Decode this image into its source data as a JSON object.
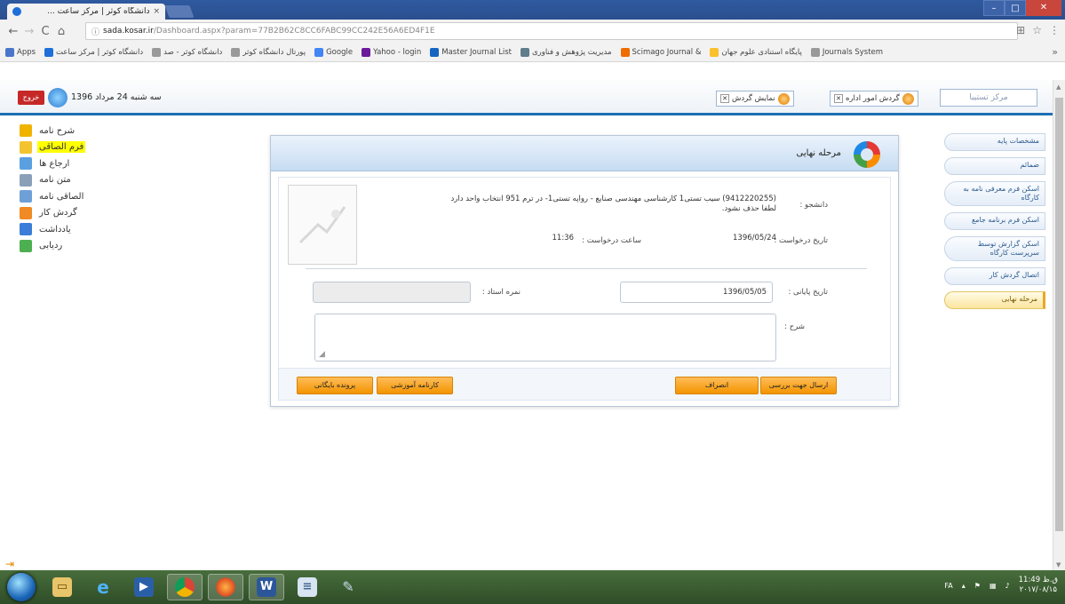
{
  "browser": {
    "tab_title": "دانشگاه کوثر | مرکز ساعت ...",
    "tab_close": "×",
    "address_domain": "sada.kosar.ir",
    "address_path": "/Dashboard.aspx?param=77B2B62C8CC6FABC99CC242E56A6ED4F1E",
    "bookmarks": [
      {
        "label": "Apps",
        "icon": "apps-icon",
        "color": "#4a76c9"
      },
      {
        "label": "دانشگاه کوثر | مرکز ساعت",
        "icon": "site-icon",
        "color": "#1e6fd9"
      },
      {
        "label": "دانشگاه کوثر - صد",
        "icon": "page-icon",
        "color": "#999999"
      },
      {
        "label": "پورتال دانشگاه کوثر",
        "icon": "page-icon",
        "color": "#999999"
      },
      {
        "label": "Google",
        "icon": "google-icon",
        "color": "#4285f4"
      },
      {
        "label": "Yahoo - login",
        "icon": "yahoo-icon",
        "color": "#6a1b9a"
      },
      {
        "label": "Master Journal List",
        "icon": "journal-icon",
        "color": "#1565c0"
      },
      {
        "label": "مدیریت پژوهش و فناوری",
        "icon": "grid-icon",
        "color": "#607d8b"
      },
      {
        "label": "Scimago Journal &",
        "icon": "scimago-icon",
        "color": "#ef6c00"
      },
      {
        "label": "پایگاه استنادی علوم جهان",
        "icon": "isc-icon",
        "color": "#fbc02d"
      },
      {
        "label": "Journals System",
        "icon": "page-icon",
        "color": "#999999"
      }
    ]
  },
  "header": {
    "logout_label": "خروج",
    "date_text": "سه شنبه 24 مرداد 1396",
    "chip_tour_label": "گردش امور اداره",
    "chip_view_label": "نمایش گردش",
    "right_box_label": "مرکز تستیبا"
  },
  "left_menu": [
    {
      "label": "شرح نامه",
      "icon": "letter-icon",
      "color": "#f0b400",
      "highlight": false
    },
    {
      "label": "فرم الصاقی",
      "icon": "form-icon",
      "color": "#f4c430",
      "highlight": true
    },
    {
      "label": "ارجاع ها",
      "icon": "refer-icon",
      "color": "#5aa0e0",
      "highlight": false
    },
    {
      "label": "متن نامه",
      "icon": "text-icon",
      "color": "#8aa0b8",
      "highlight": false
    },
    {
      "label": "الصاقی نامه",
      "icon": "attach-icon",
      "color": "#6ea0d8",
      "highlight": false
    },
    {
      "label": "گردش کار",
      "icon": "workflow-icon",
      "color": "#f08a24",
      "highlight": false
    },
    {
      "label": "یادداشت",
      "icon": "note-icon",
      "color": "#3b7dd8",
      "highlight": false
    },
    {
      "label": "ردیابی",
      "icon": "track-icon",
      "color": "#4caf50",
      "highlight": false
    }
  ],
  "right_menu": [
    {
      "label": "مشخصات پایه",
      "active": false
    },
    {
      "label": "ضمائم",
      "active": false
    },
    {
      "label": "اسکن فرم معرفی نامه به کارگاه",
      "active": false
    },
    {
      "label": "اسکن فرم برنامه جامع",
      "active": false
    },
    {
      "label": "اسکن گزارش توسط سرپرست کارگاه",
      "active": false
    },
    {
      "label": "اتصال گردش کار",
      "active": false
    },
    {
      "label": "مرحله نهایی",
      "active": true
    }
  ],
  "panel": {
    "title": "مرحله نهایی",
    "student_label": "دانشجو :",
    "student_value": "(9412220255) سیب تستی1 کارشناسی مهندسی صنایع - رواپه تستی1- در ترم 951 انتخاب واحد دارد",
    "student_value_line2": "لطفا حذف نشود.",
    "request_date_label": "تاریخ درخواست :",
    "request_date_value": "1396/05/24",
    "request_time_label": "ساعت درخواست :",
    "request_time_value": "11:36",
    "end_date_label": "تاریخ پایانی :",
    "end_date_value": "1396/05/05",
    "teacher_grade_label": "نمره استاد :",
    "teacher_grade_value": "",
    "description_label": "شرح :",
    "buttons": {
      "send_review": "ارسال جهت بررسی",
      "cancel": "انصراف",
      "transcript": "کارنامه آموزشی",
      "archive": "پرونده بایگانی"
    }
  },
  "taskbar": {
    "lang": "FA",
    "time": "11:49 ق.ظ",
    "date": "۲۰۱۷/۰۸/۱۵"
  }
}
